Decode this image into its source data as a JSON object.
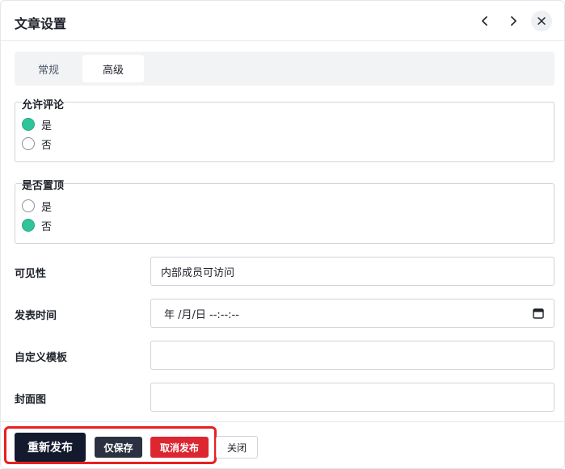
{
  "dialog": {
    "title": "文章设置",
    "nav_icons": [
      "chevron-left-icon",
      "chevron-right-icon",
      "close-icon"
    ]
  },
  "tabs": [
    {
      "label": "常规",
      "active": false
    },
    {
      "label": "高级",
      "active": true
    }
  ],
  "allow_comments": {
    "legend": "允许评论",
    "options": [
      {
        "label": "是",
        "checked": true
      },
      {
        "label": "否",
        "checked": false
      }
    ]
  },
  "pin_top": {
    "legend": "是否置顶",
    "options": [
      {
        "label": "是",
        "checked": false
      },
      {
        "label": "否",
        "checked": true
      }
    ]
  },
  "fields": {
    "visibility": {
      "label": "可见性",
      "value": "内部成员可访问"
    },
    "publish_time": {
      "label": "发表时间",
      "value": "年 /月/日 --:--:--"
    },
    "custom_template": {
      "label": "自定义模板",
      "value": ""
    },
    "cover_image": {
      "label": "封面图",
      "value": ""
    }
  },
  "footer": {
    "republish": "重新发布",
    "save_only": "仅保存",
    "unpublish": "取消发布",
    "close": "关闭"
  },
  "colors": {
    "radio_checked": "#2fc59a",
    "primary_button": "#141a2e",
    "danger_button": "#dc2630",
    "highlight_border": "#e8201f"
  }
}
